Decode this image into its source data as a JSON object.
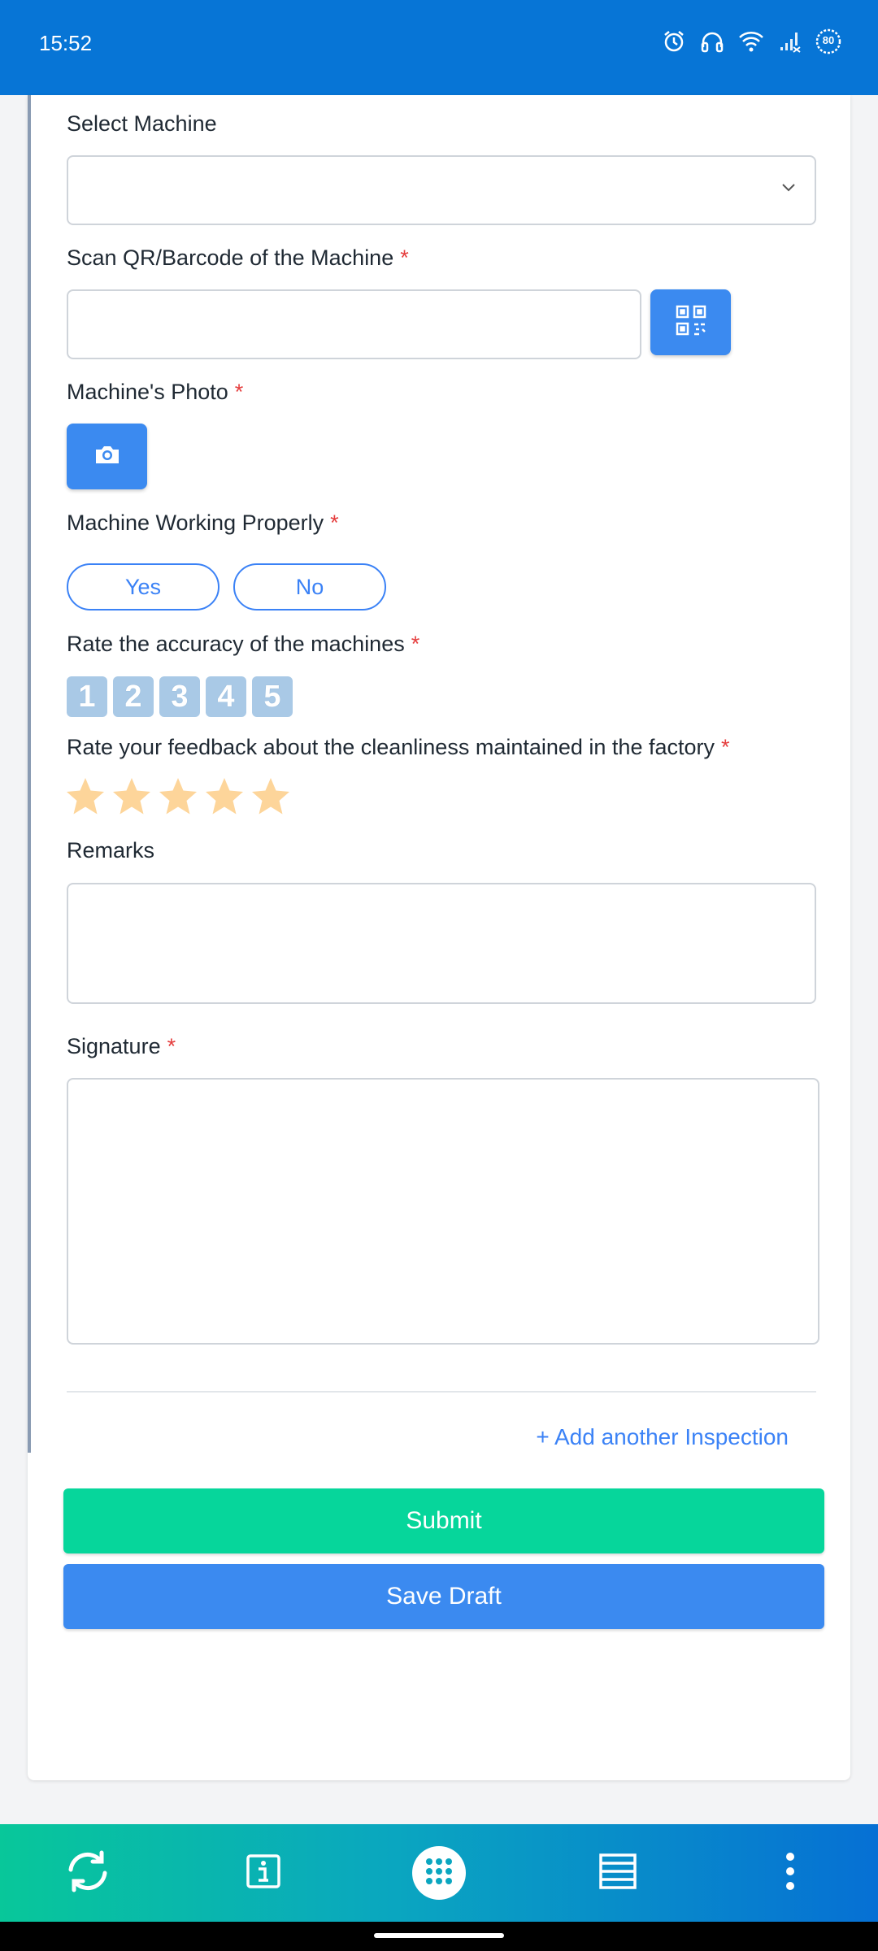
{
  "status_bar": {
    "time": "15:52",
    "battery": "80",
    "icons": [
      "alarm-icon",
      "headphones-icon",
      "wifi-icon",
      "signal-icon",
      "battery-icon"
    ]
  },
  "form": {
    "select_machine": {
      "label": "Select Machine",
      "value": ""
    },
    "scan_qr": {
      "label": "Scan QR/Barcode of the Machine",
      "required": "*",
      "value": ""
    },
    "machine_photo": {
      "label": "Machine's Photo",
      "required": "*"
    },
    "working_properly": {
      "label": "Machine Working Properly",
      "required": "*",
      "options": [
        "Yes",
        "No"
      ]
    },
    "accuracy": {
      "label": "Rate the accuracy of the machines",
      "required": "*",
      "options": [
        "1",
        "2",
        "3",
        "4",
        "5"
      ]
    },
    "cleanliness": {
      "label": "Rate your feedback about the cleanliness maintained in the factory",
      "required": "*",
      "stars": 5
    },
    "remarks": {
      "label": "Remarks",
      "value": ""
    },
    "signature": {
      "label": "Signature",
      "required": "*"
    }
  },
  "actions": {
    "add_inspection": "+ Add another Inspection",
    "submit": "Submit",
    "save_draft": "Save Draft"
  },
  "colors": {
    "status_bar": "#0775d6",
    "submit": "#06d69b",
    "save_draft": "#3b8af0",
    "accent": "#3b82f6",
    "required": "#e53e3e",
    "star": "#fdd59a"
  },
  "bottom_nav": [
    "sync-icon",
    "info-icon",
    "apps-grid-icon",
    "list-icon",
    "more-vertical-icon"
  ]
}
